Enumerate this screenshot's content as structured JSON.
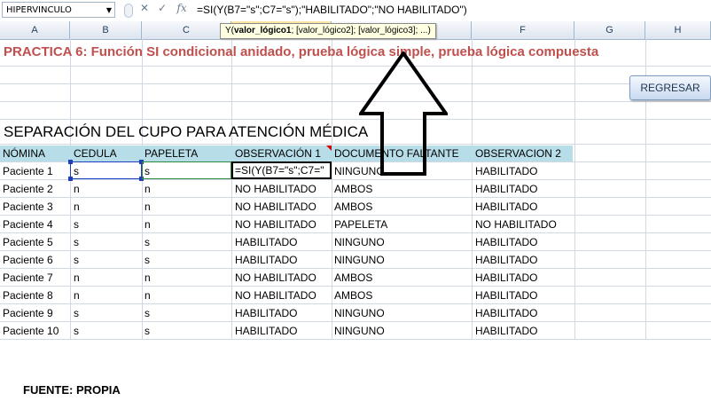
{
  "name_box": "HIPERVINCULO",
  "formula_bar": {
    "cancel_glyph": "✕",
    "enter_glyph": "✓",
    "fx_label": "fx",
    "formula": "=SI(Y(B7=\"s\";C7=\"s\");\"HABILITADO\";\"NO HABILITADO\")",
    "hint_prefix": "Y(",
    "hint_bold": "valor_lógico1",
    "hint_rest": "; [valor_lógico2]; [valor_lógico3]; ...)"
  },
  "columns": [
    "A",
    "B",
    "C",
    "D",
    "E",
    "F",
    "G",
    "H"
  ],
  "sheet": {
    "title": "PRACTICA 6: Función SI condicional anidado, prueba lógica simple, prueba lógica compuesta",
    "button_label": "REGRESAR",
    "subtitle": "SEPARACIÓN DEL CUPO PARA ATENCIÓN MÉDICA",
    "headers": [
      "NÓMINA",
      "CEDULA",
      "PAPELETA",
      "OBSERVACIÓN 1",
      "DOCUMENTO FALTANTE",
      "OBSERVACION 2"
    ],
    "editing_text": "=SI(Y(B7=\"s\";C7=\"",
    "rows": [
      [
        "Paciente 1",
        "s",
        "s",
        "",
        "NINGUNO",
        "HABILITADO"
      ],
      [
        "Paciente 2",
        "n",
        "n",
        "NO HABILITADO",
        "AMBOS",
        "HABILITADO"
      ],
      [
        "Paciente 3",
        "n",
        "n",
        "NO HABILITADO",
        "AMBOS",
        "HABILITADO"
      ],
      [
        "Paciente 4",
        "s",
        "n",
        "NO HABILITADO",
        "PAPELETA",
        "NO HABILITADO"
      ],
      [
        "Paciente 5",
        "s",
        "s",
        "HABILITADO",
        "NINGUNO",
        "HABILITADO"
      ],
      [
        "Paciente 6",
        "s",
        "s",
        "HABILITADO",
        "NINGUNO",
        "HABILITADO"
      ],
      [
        "Paciente 7",
        "n",
        "n",
        "NO HABILITADO",
        "AMBOS",
        "HABILITADO"
      ],
      [
        "Paciente 8",
        "n",
        "n",
        "NO HABILITADO",
        "AMBOS",
        "HABILITADO"
      ],
      [
        "Paciente 9",
        "s",
        "s",
        "HABILITADO",
        "NINGUNO",
        "HABILITADO"
      ],
      [
        "Paciente 10",
        "s",
        "s",
        "HABILITADO",
        "NINGUNO",
        "HABILITADO"
      ]
    ],
    "source": "FUENTE: PROPIA"
  },
  "colors": {
    "title": "#c0504d",
    "table_header": "#b7dee8",
    "selection_blue": "#1f3fbf",
    "selection_green": "#2e8b3e"
  },
  "icons": [
    "dropdown-arrow-icon",
    "cancel-icon",
    "enter-icon",
    "fx-icon",
    "comment-indicator-icon",
    "up-arrow-annotation"
  ]
}
